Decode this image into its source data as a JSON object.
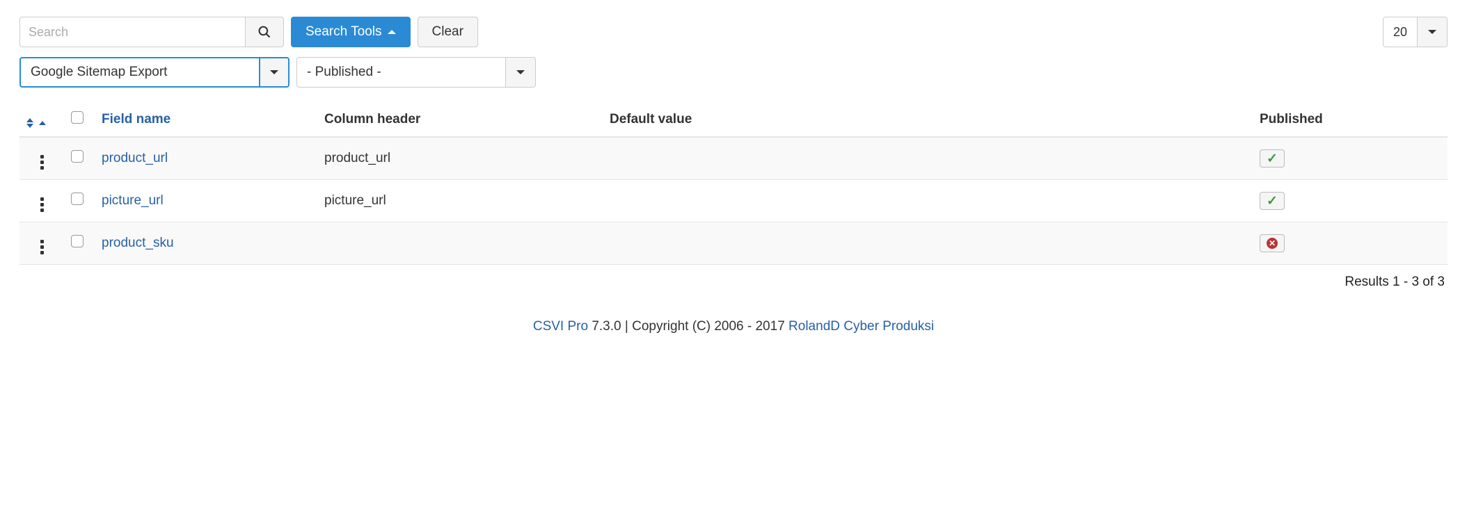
{
  "toolbar": {
    "search_placeholder": "Search",
    "search_tools_label": "Search Tools",
    "clear_label": "Clear",
    "limit_value": "20"
  },
  "filters": {
    "template_selected": "Google Sitemap Export",
    "published_selected": "- Published -"
  },
  "columns": {
    "field_name": "Field name",
    "column_header": "Column header",
    "default_value": "Default value",
    "published": "Published"
  },
  "rows": [
    {
      "field_name": "product_url",
      "column_header": "product_url",
      "default_value": "",
      "published": true
    },
    {
      "field_name": "picture_url",
      "column_header": "picture_url",
      "default_value": "",
      "published": true
    },
    {
      "field_name": "product_sku",
      "column_header": "",
      "default_value": "",
      "published": false
    }
  ],
  "results_text": "Results 1 - 3 of 3",
  "footer": {
    "product_link": "CSVI Pro",
    "version_text": " 7.3.0 | Copyright (C) 2006 - 2017 ",
    "company_link": "RolandD Cyber Produksi"
  }
}
